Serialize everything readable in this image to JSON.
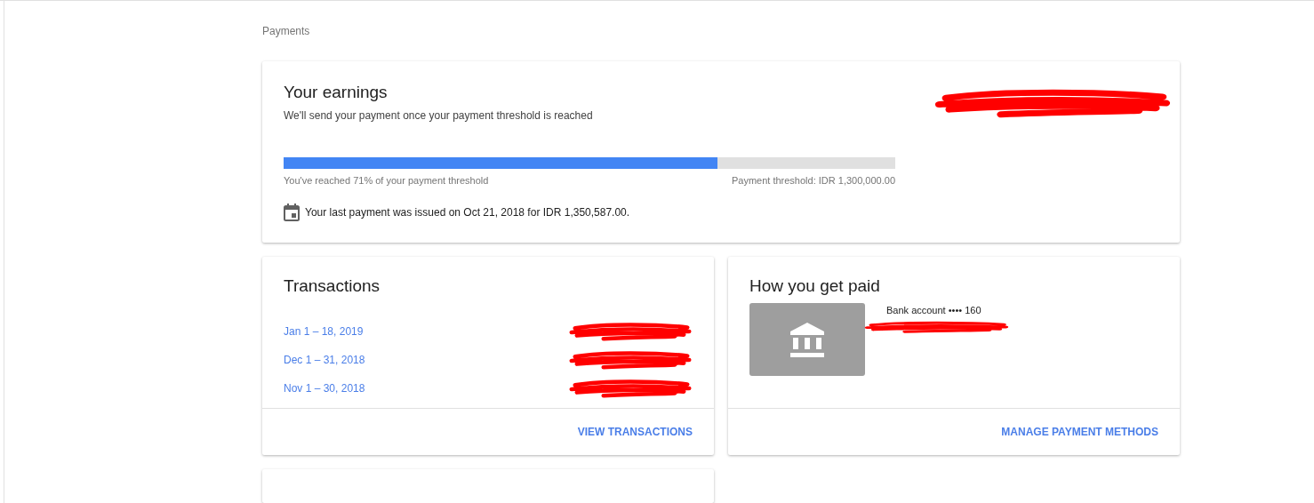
{
  "breadcrumb": "Payments",
  "earnings": {
    "title": "Your earnings",
    "subtitle": "We'll send your payment once your payment threshold is reached",
    "amount_redacted": true,
    "level": 0.71,
    "progress_text": "You've reached 71% of your payment threshold",
    "threshold_text": "Payment threshold: IDR 1,300,000.00",
    "last_payment": "Your last payment was issued on Oct 21, 2018 for IDR 1,350,587.00."
  },
  "transactions": {
    "title": "Transactions",
    "rows": [
      {
        "period": "Jan 1 – 18, 2019",
        "amount_redacted": true
      },
      {
        "period": "Dec 1 – 31, 2018",
        "amount_redacted": true
      },
      {
        "period": "Nov 1 – 30, 2018",
        "amount_redacted": true
      }
    ],
    "action": "VIEW TRANSACTIONS"
  },
  "payment_method": {
    "title": "How you get paid",
    "account": "Bank account •••• 160",
    "holder_redacted": true,
    "action": "MANAGE PAYMENT METHODS"
  },
  "settings_card": {
    "kind": "card"
  }
}
